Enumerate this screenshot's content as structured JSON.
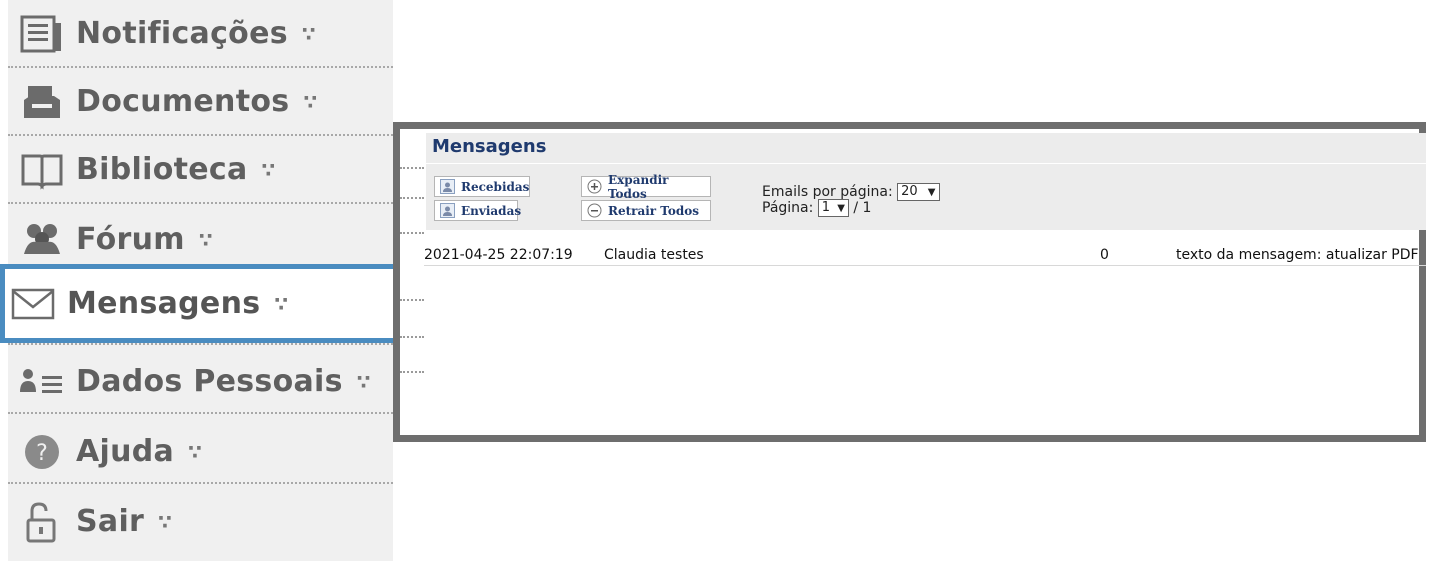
{
  "sidebar": {
    "items": [
      {
        "label": "Notificações",
        "icon": "newspaper-icon"
      },
      {
        "label": "Documentos",
        "icon": "tray-icon"
      },
      {
        "label": "Biblioteca",
        "icon": "book-icon"
      },
      {
        "label": "Fórum",
        "icon": "people-icon"
      },
      {
        "label": "Mensagens",
        "icon": "envelope-icon"
      },
      {
        "label": "Dados Pessoais",
        "icon": "person-list-icon"
      },
      {
        "label": "Ajuda",
        "icon": "help-icon"
      },
      {
        "label": "Sair",
        "icon": "unlock-icon"
      }
    ],
    "arrow_glyph": "∵",
    "active_item": "Mensagens",
    "active_border_color": "#4a8cc0"
  },
  "panel": {
    "title": "Mensagens",
    "title_color": "#1f3a6e",
    "buttons": {
      "received": "Recebidas",
      "sent": "Enviadas",
      "expand_all": "Expandir Todos",
      "collapse_all": "Retrair Todos"
    },
    "emails_per_page_label": "Emails por página:",
    "emails_per_page_value": "20",
    "page_label": "Página:",
    "page_value": "1",
    "page_total": "/ 1",
    "messages": [
      {
        "date": "2021-04-25 22:07:19",
        "from": "Claudia testes",
        "count": "0",
        "subject": "texto da mensagem: atualizar PDF"
      }
    ]
  }
}
